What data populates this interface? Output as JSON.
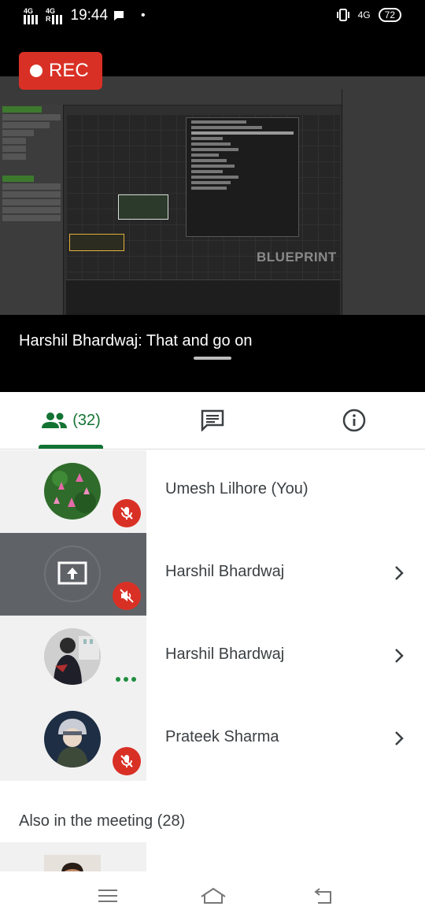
{
  "status_bar": {
    "net_label_1": "4G",
    "net_label_2": "4G",
    "roaming": "R",
    "time": "19:44",
    "net_right": "4G",
    "battery": "72"
  },
  "video": {
    "rec_label": "REC",
    "watermark": "BLUEPRINT",
    "caption": "Harshil Bhardwaj: That and go on"
  },
  "tabs": {
    "people_count": "(32)",
    "people_icon": "people-icon",
    "chat_icon": "chat-icon",
    "info_icon": "info-icon"
  },
  "participants": [
    {
      "name": "Umesh Lilhore (You)",
      "status": "muted",
      "avatar": "lotus-photo"
    },
    {
      "name": "Harshil Bhardwaj",
      "status": "muted",
      "avatar": "presenting-icon"
    },
    {
      "name": "Harshil Bhardwaj",
      "status": "speaking",
      "avatar": "person-photo"
    },
    {
      "name": "Prateek Sharma",
      "status": "muted",
      "avatar": "anime-photo"
    }
  ],
  "also_in_meeting": "Also in the meeting (28)",
  "colors": {
    "accent_green": "#137333",
    "mute_red": "#d93025",
    "active_row": "#5f6368"
  }
}
